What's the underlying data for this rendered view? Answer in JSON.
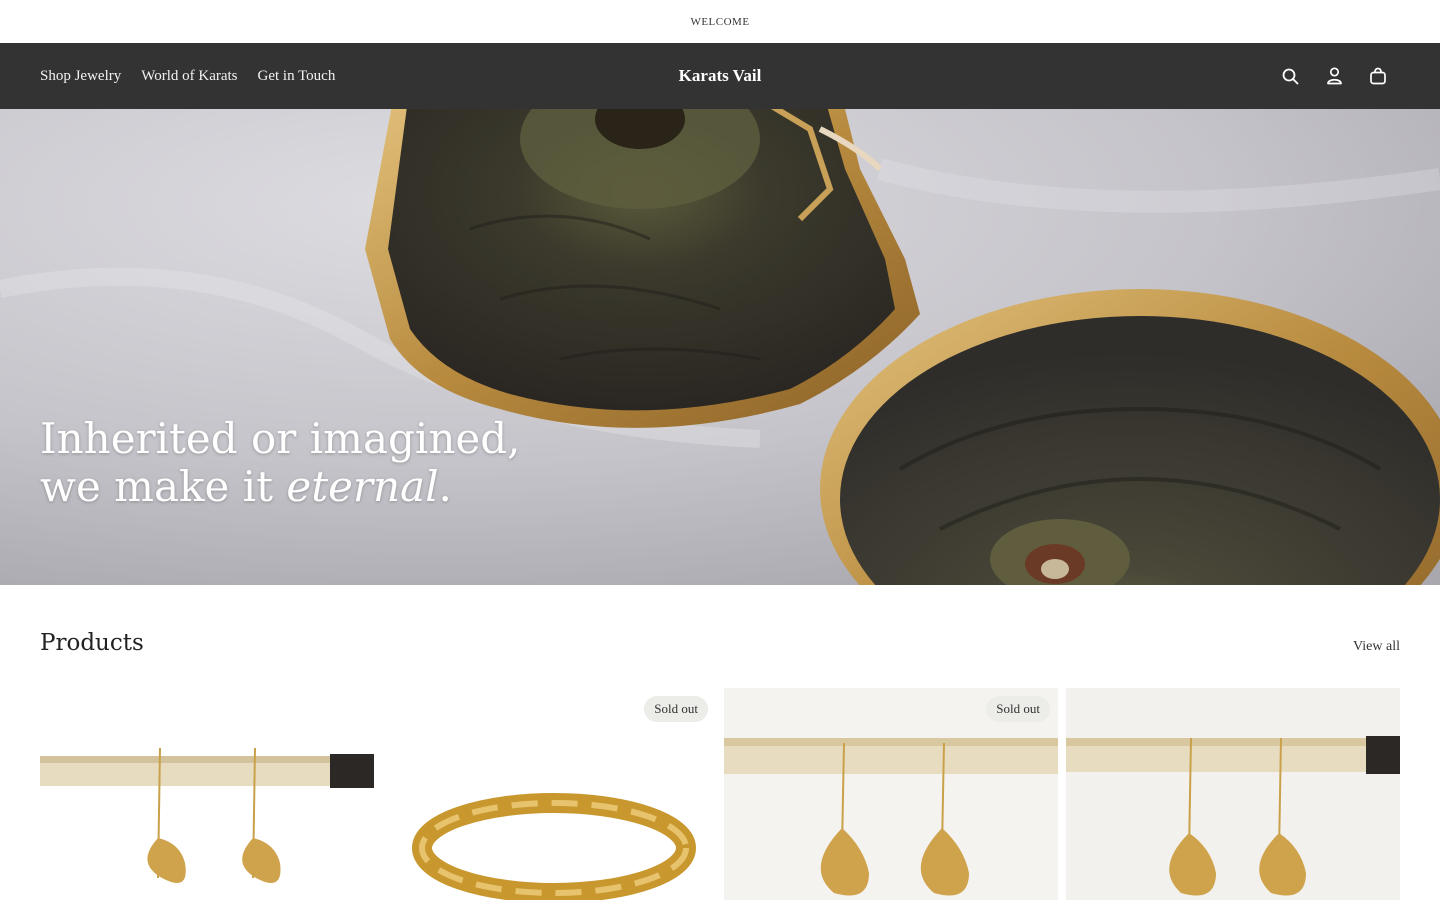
{
  "announcement": {
    "text": "WELCOME"
  },
  "header": {
    "nav": [
      {
        "label": "Shop Jewelry"
      },
      {
        "label": "World of Karats"
      },
      {
        "label": "Get in Touch"
      }
    ],
    "brand": "Karats Vail",
    "icons": [
      "search-icon",
      "account-icon",
      "cart-icon"
    ]
  },
  "hero": {
    "line1": "Inherited or imagined,",
    "line2_prefix": "we make it ",
    "line2_italic": "eternal",
    "line2_suffix": "."
  },
  "products": {
    "title": "Products",
    "view_all": "View all",
    "items": [
      {
        "badge": ""
      },
      {
        "badge": "Sold out"
      },
      {
        "badge": "Sold out"
      },
      {
        "badge": ""
      }
    ]
  },
  "colors": {
    "header_bg": "#333333",
    "badge_bg": "#ecece8",
    "gold": "#c9a14a"
  }
}
